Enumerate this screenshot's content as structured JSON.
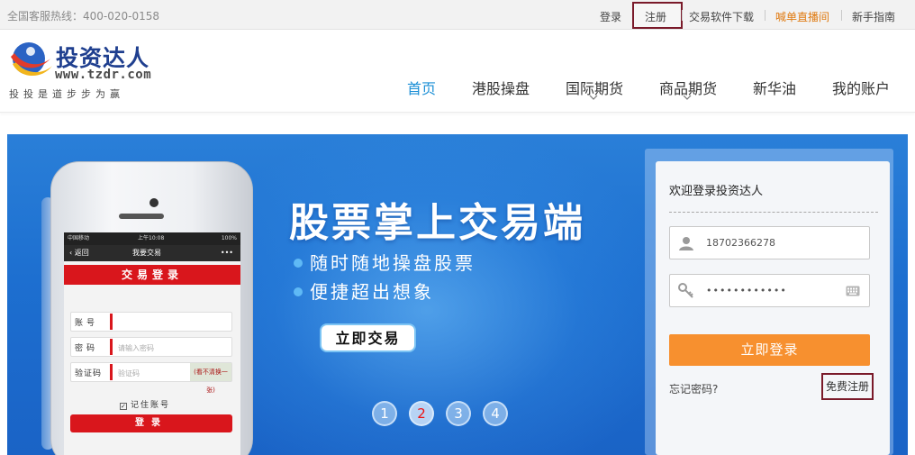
{
  "topbar": {
    "hotline": "全国客服热线：400-020-0158",
    "links": [
      "登录",
      "注册",
      "交易软件下载",
      "喊单直播间",
      "新手指南"
    ]
  },
  "logo": {
    "name": "投资达人",
    "url": "www.tzdr.com",
    "slogan": "投投是道步步为赢"
  },
  "nav": {
    "items": [
      "首页",
      "港股操盘",
      "国际期货",
      "商品期货",
      "新华油",
      "我的账户"
    ],
    "active": "首页"
  },
  "banner": {
    "headline": "股票掌上交易端",
    "features": [
      "随时随地操盘股票",
      "便捷超出想象"
    ],
    "cta": "立即交易",
    "pages": [
      "1",
      "2",
      "3",
      "4"
    ],
    "active_page": "2",
    "phone": {
      "carrier": "中国移动",
      "time": "上午10:08",
      "battery": "100%",
      "back": "返回",
      "title": "我要交易",
      "more": "•••",
      "form_title": "交易登录",
      "account_label": "账号",
      "password_label": "密码",
      "password_placeholder": "请输入密码",
      "captcha_label": "验证码",
      "captcha_placeholder": "验证码",
      "captcha_hint": "(看不清换一张)",
      "remember": "记住账号",
      "login": "登录"
    }
  },
  "login": {
    "title": "欢迎登录投资达人",
    "username": "18702366278",
    "password_mask": "••••••••••••",
    "submit": "立即登录",
    "forgot": "忘记密码?",
    "register": "免费注册"
  },
  "colors": {
    "accent": "#1b8fd6",
    "login_button": "#f7902f",
    "live_link": "#e07a10",
    "banner_blue": "#1d6fd0",
    "highlight_box": "#7a1a2a"
  }
}
